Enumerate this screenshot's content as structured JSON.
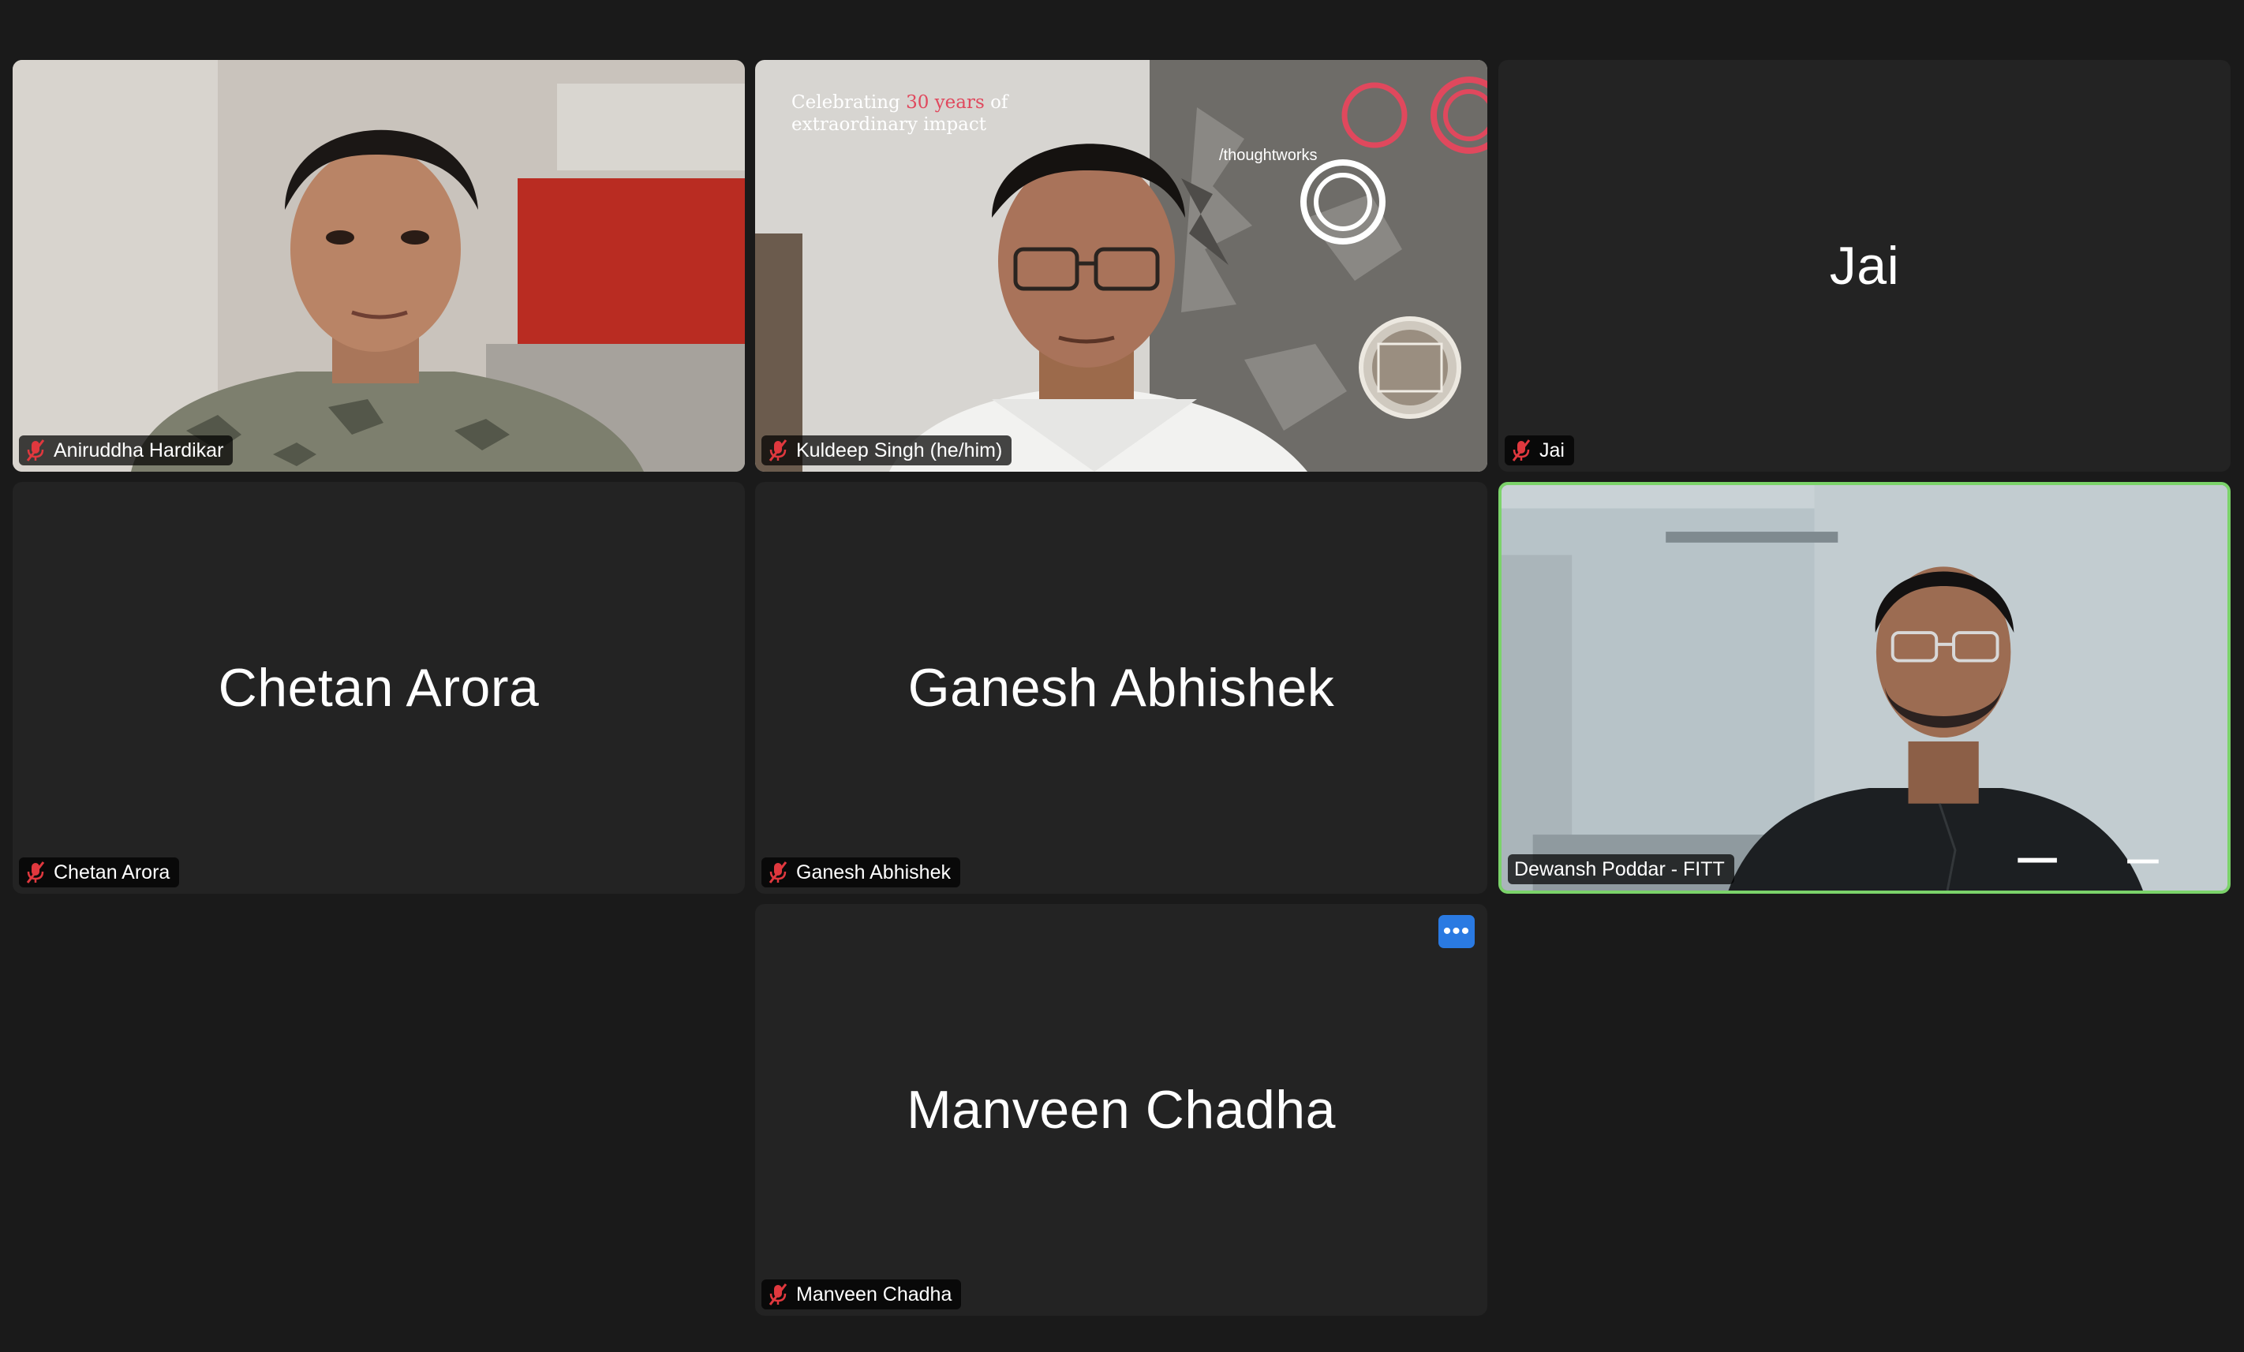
{
  "meeting": {
    "participants": [
      {
        "name": "Aniruddha Hardikar",
        "muted": true,
        "video": true
      },
      {
        "name": "Kuldeep Singh (he/him)",
        "muted": true,
        "video": true
      },
      {
        "name": "Jai",
        "muted": true,
        "video": false
      },
      {
        "name": "Chetan Arora",
        "muted": true,
        "video": false
      },
      {
        "name": "Ganesh Abhishek",
        "muted": true,
        "video": false
      },
      {
        "name": "Dewansh Poddar - FITT",
        "muted": false,
        "video": true,
        "active_speaker": true
      },
      {
        "name": "Manveen Chadha",
        "muted": true,
        "video": false
      }
    ],
    "background_banner": {
      "line1_prefix": "Celebrating ",
      "line1_highlight": "30 years",
      "line1_suffix": " of",
      "line2": "extraordinary impact",
      "brand": "/thoughtworks"
    },
    "more_options_label": "•••"
  },
  "colors": {
    "background": "#1a1a1a",
    "tile": "#232323",
    "active_border": "#7bd36a",
    "mute_red": "#e0383e",
    "more_button": "#2a7ae2",
    "brand_pink": "#e0485d"
  }
}
